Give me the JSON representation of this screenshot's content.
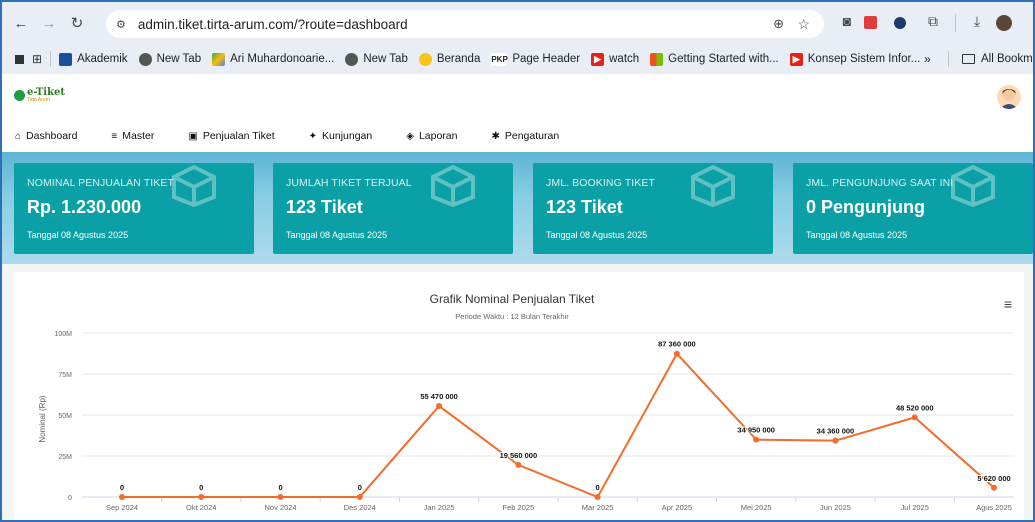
{
  "browser": {
    "url": "admin.tiket.tirta-arum.com/?route=dashboard",
    "bookmarks": [
      "Akademik",
      "New Tab",
      "Ari Muhardonoarie...",
      "New Tab",
      "Beranda",
      "Page Header",
      "watch",
      "Getting Started with...",
      "Konsep Sistem Infor..."
    ],
    "overflow": "»",
    "all_bookmarks": "All Bookmarks"
  },
  "app": {
    "logo_text": "e-Tiket",
    "logo_sub": "Tirta Arum",
    "menu": [
      {
        "label": "Dashboard",
        "icon": "home-icon"
      },
      {
        "label": "Master",
        "icon": "database-icon"
      },
      {
        "label": "Penjualan Tiket",
        "icon": "bag-icon"
      },
      {
        "label": "Kunjungan",
        "icon": "walking-icon"
      },
      {
        "label": "Laporan",
        "icon": "stack-icon"
      },
      {
        "label": "Pengaturan",
        "icon": "gear-icon"
      }
    ]
  },
  "cards": [
    {
      "title": "NOMINAL PENJUALAN TIKET",
      "value": "Rp. 1.230.000",
      "date": "Tanggal 08 Agustus 2025"
    },
    {
      "title": "JUMLAH TIKET TERJUAL",
      "value": "123 Tiket",
      "date": "Tanggal 08 Agustus 2025"
    },
    {
      "title": "JML. BOOKING TIKET",
      "value": "123 Tiket",
      "date": "Tanggal 08 Agustus 2025"
    },
    {
      "title": "JML. PENGUNJUNG SAAT INI",
      "value": "0 Pengunjung",
      "date": "Tanggal 08 Agustus 2025"
    }
  ],
  "colors": {
    "card": "#0ba0a6",
    "line": "#f26c2a",
    "accent": "#2f6fb8"
  },
  "chart_data": {
    "type": "line",
    "title": "Grafik Nominal Penjualan Tiket",
    "subtitle": "Periode Waktu : 12 Bulan Terakhir",
    "ylabel": "Nominal (Rp)",
    "xlabel": "",
    "categories": [
      "Sep 2024",
      "Okt 2024",
      "Nov 2024",
      "Des 2024",
      "Jan 2025",
      "Feb 2025",
      "Mar 2025",
      "Apr 2025",
      "Mei 2025",
      "Jun 2025",
      "Jul 2025",
      "Agus 2025"
    ],
    "values": [
      0,
      0,
      0,
      0,
      55470000,
      19560000,
      0,
      87360000,
      34950000,
      34360000,
      48520000,
      5620000
    ],
    "data_labels": [
      "0",
      "0",
      "0",
      "0",
      "55 470 000",
      "19 560 000",
      "0",
      "87 360 000",
      "34 950 000",
      "34 360 000",
      "48 520 000",
      "5 620 000"
    ],
    "yticks": [
      "0",
      "25M",
      "50M",
      "75M",
      "100M"
    ],
    "ylim": [
      0,
      100000000
    ],
    "grid": true
  }
}
